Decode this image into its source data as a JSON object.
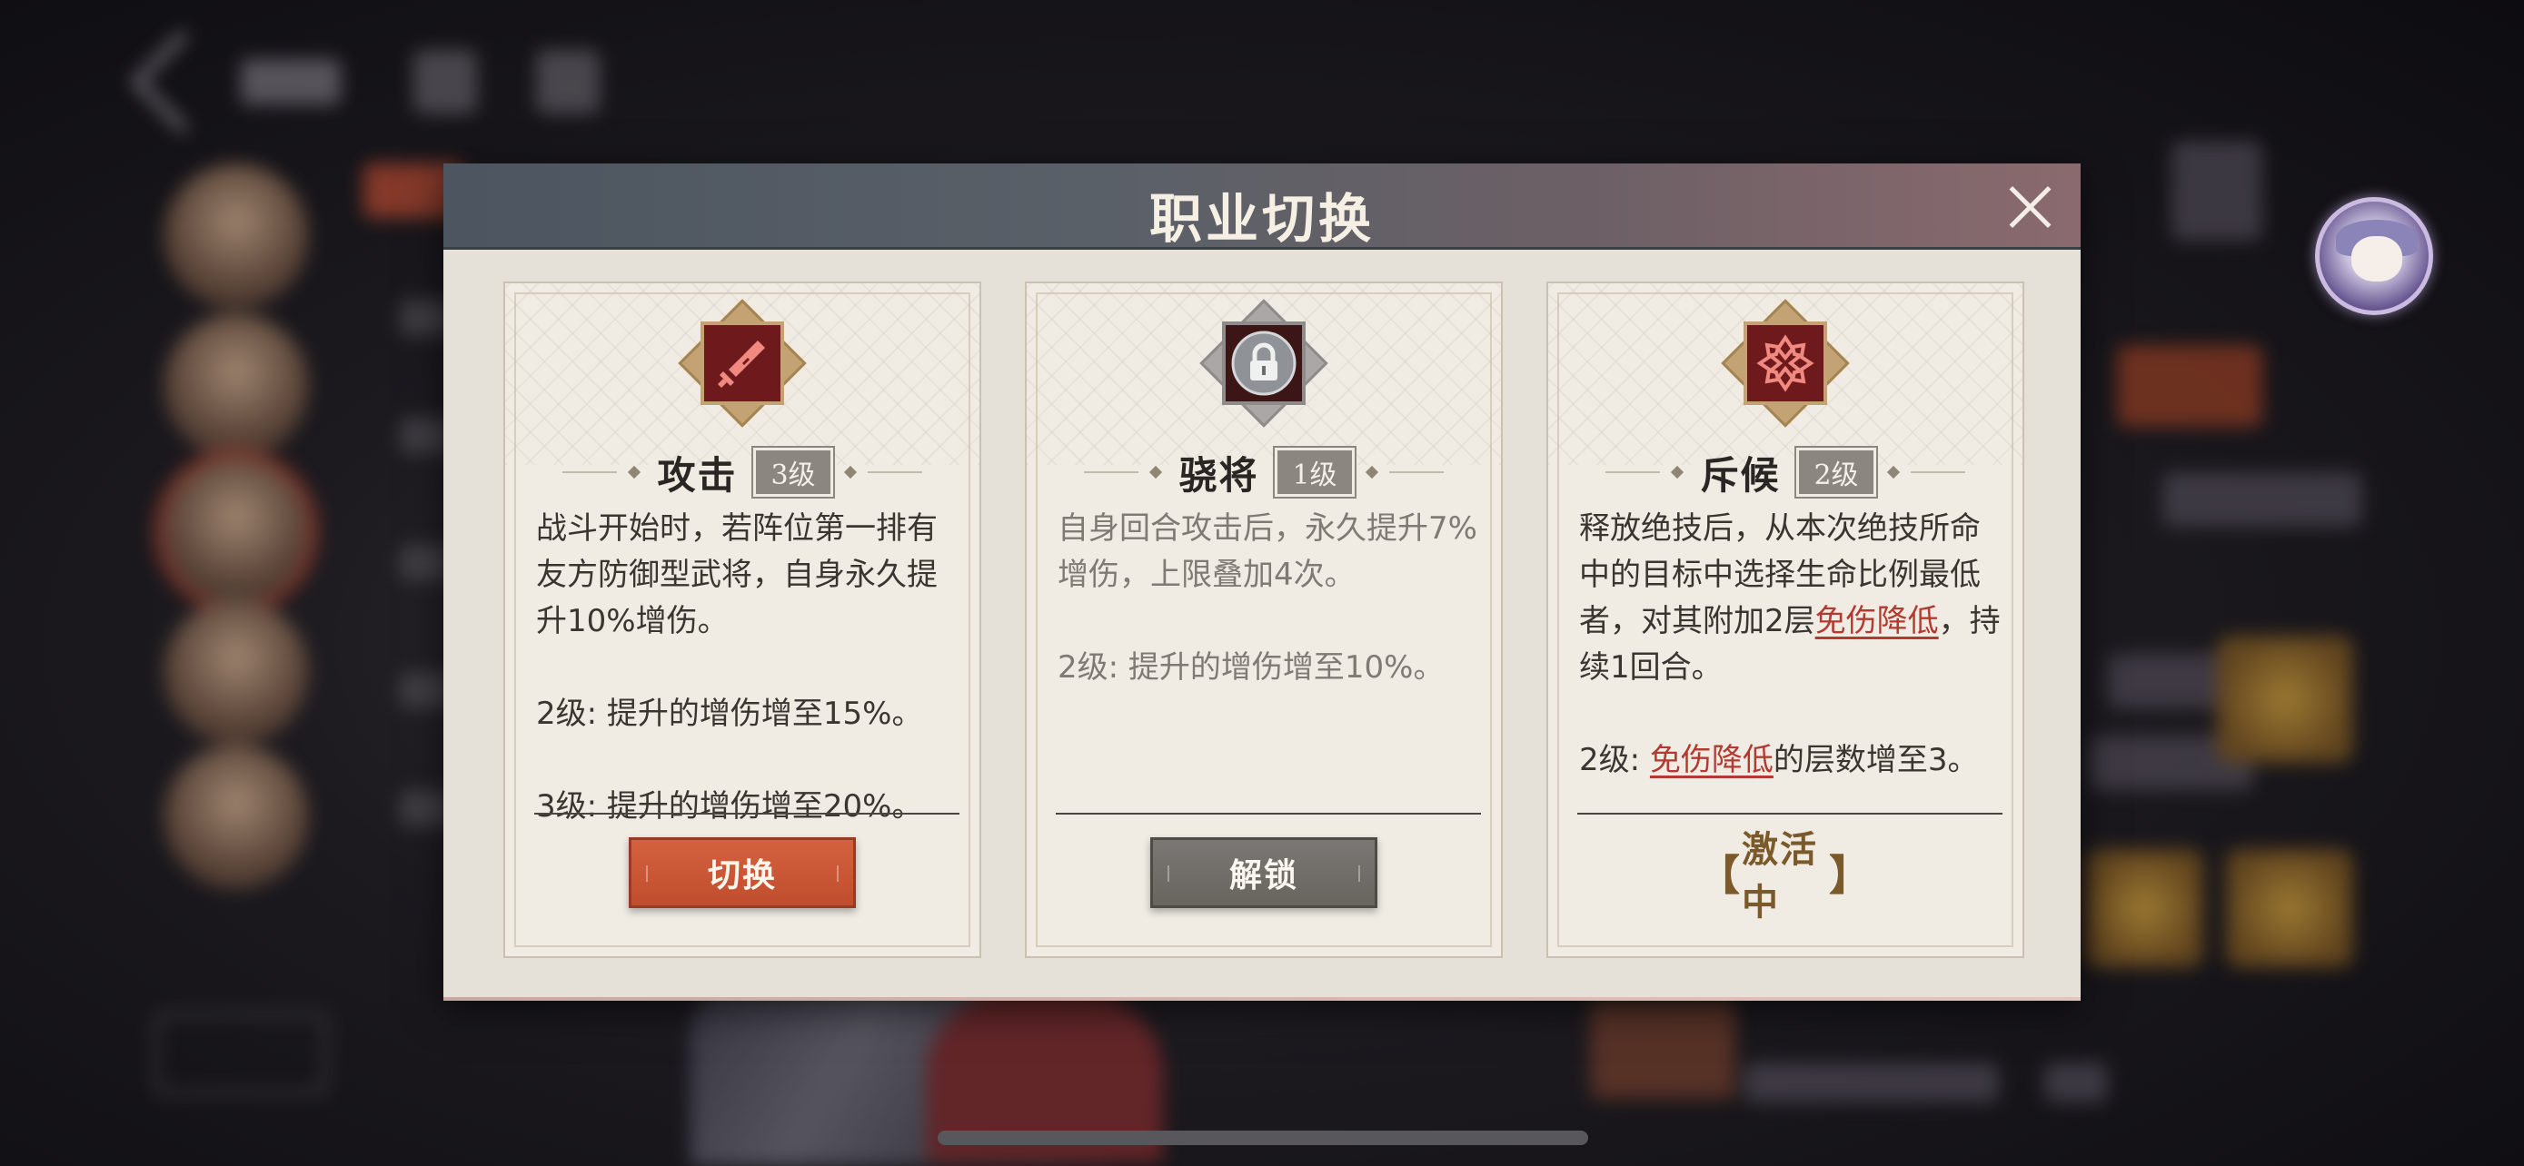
{
  "modal": {
    "title": "职业切换"
  },
  "cards": [
    {
      "name": "攻击",
      "level": "3级",
      "icon": "sword-icon",
      "description": [
        "战斗开始时，若阵位第一排有友方防御型武将，自身永久提升10%增伤。",
        "2级: 提升的增伤增至15%。",
        "3级: 提升的增伤增至20%。"
      ],
      "button": "切换"
    },
    {
      "name": "骁将",
      "level": "1级",
      "icon": "lock-icon",
      "description": [
        "自身回合攻击后，永久提升7%增伤，上限叠加4次。",
        "2级: 提升的增伤增至10%。"
      ],
      "button": "解锁"
    },
    {
      "name": "斥候",
      "level": "2级",
      "icon": "flower-emblem-icon",
      "description_parts": {
        "p1_a": "释放绝技后，从本次绝技所命中的目标中选择生命比例最低者，对其附加2层",
        "keyword": "免伤降低",
        "p1_b": "，持续1回合。",
        "p2_a": "2级: ",
        "p2_b": "的层数增至3。"
      },
      "status": "激活中",
      "status_left": "【",
      "status_right": "】"
    }
  ],
  "colors": {
    "accent_orange": "#c8563a",
    "keyword_red": "#b23a30",
    "emblem_red": "#6e1a1c",
    "gold": "#c3a374"
  }
}
